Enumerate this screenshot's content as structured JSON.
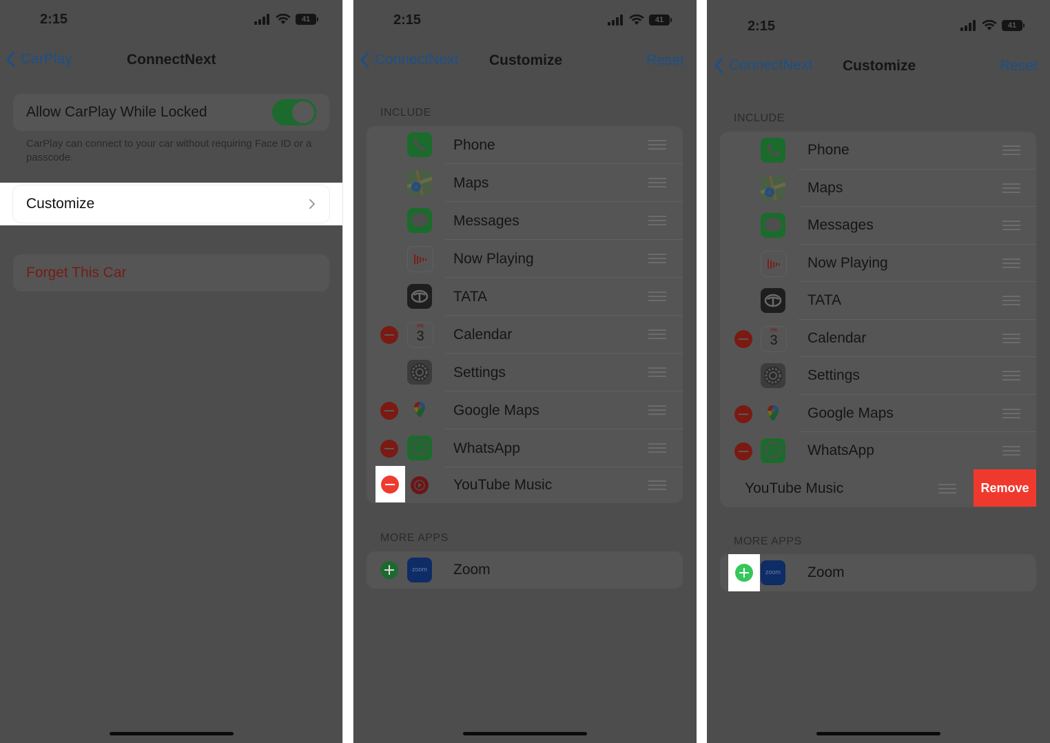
{
  "status": {
    "time": "2:15",
    "battery": "41"
  },
  "screen1": {
    "back_label": "CarPlay",
    "title": "ConnectNext",
    "allow_label": "Allow CarPlay While Locked",
    "allow_on": true,
    "allow_footer": "CarPlay can connect to your car without requiring Face ID or a passcode.",
    "customize_label": "Customize",
    "forget_label": "Forget This Car"
  },
  "screen2": {
    "back_label": "ConnectNext",
    "title": "Customize",
    "reset_label": "Reset",
    "include_header": "INCLUDE",
    "more_header": "MORE APPS",
    "include": [
      {
        "label": "Phone",
        "icon": "phone-icon"
      },
      {
        "label": "Maps",
        "icon": "maps-icon"
      },
      {
        "label": "Messages",
        "icon": "messages-icon"
      },
      {
        "label": "Now Playing",
        "icon": "now-playing-icon"
      },
      {
        "label": "TATA",
        "icon": "tata-icon"
      },
      {
        "label": "Calendar",
        "icon": "calendar-icon",
        "removable": true
      },
      {
        "label": "Settings",
        "icon": "settings-icon"
      },
      {
        "label": "Google Maps",
        "icon": "google-maps-icon",
        "removable": true
      },
      {
        "label": "WhatsApp",
        "icon": "whatsapp-icon",
        "removable": true
      },
      {
        "label": "YouTube Music",
        "icon": "youtube-music-icon",
        "removable": true,
        "highlighted": true
      }
    ],
    "more": [
      {
        "label": "Zoom",
        "icon": "zoom-icon"
      }
    ]
  },
  "screen3": {
    "back_label": "ConnectNext",
    "title": "Customize",
    "reset_label": "Reset",
    "include_header": "INCLUDE",
    "more_header": "MORE APPS",
    "include": [
      {
        "label": "Phone"
      },
      {
        "label": "Maps"
      },
      {
        "label": "Messages"
      },
      {
        "label": "Now Playing"
      },
      {
        "label": "TATA"
      },
      {
        "label": "Calendar"
      },
      {
        "label": "Settings"
      },
      {
        "label": "Google Maps"
      },
      {
        "label": "WhatsApp"
      },
      {
        "label": "YouTube Music"
      }
    ],
    "remove_label": "Remove",
    "more": [
      {
        "label": "Zoom"
      }
    ]
  },
  "icons": {
    "calendar_day": "FRI",
    "calendar_date": "3",
    "zoom_text": "zoom"
  },
  "colors": {
    "dim_background": "#4d4d4d",
    "link_blue": "#1d4f86",
    "destructive_red": "#ee3b30",
    "add_green": "#34c759",
    "highlight": "#ffffff"
  }
}
